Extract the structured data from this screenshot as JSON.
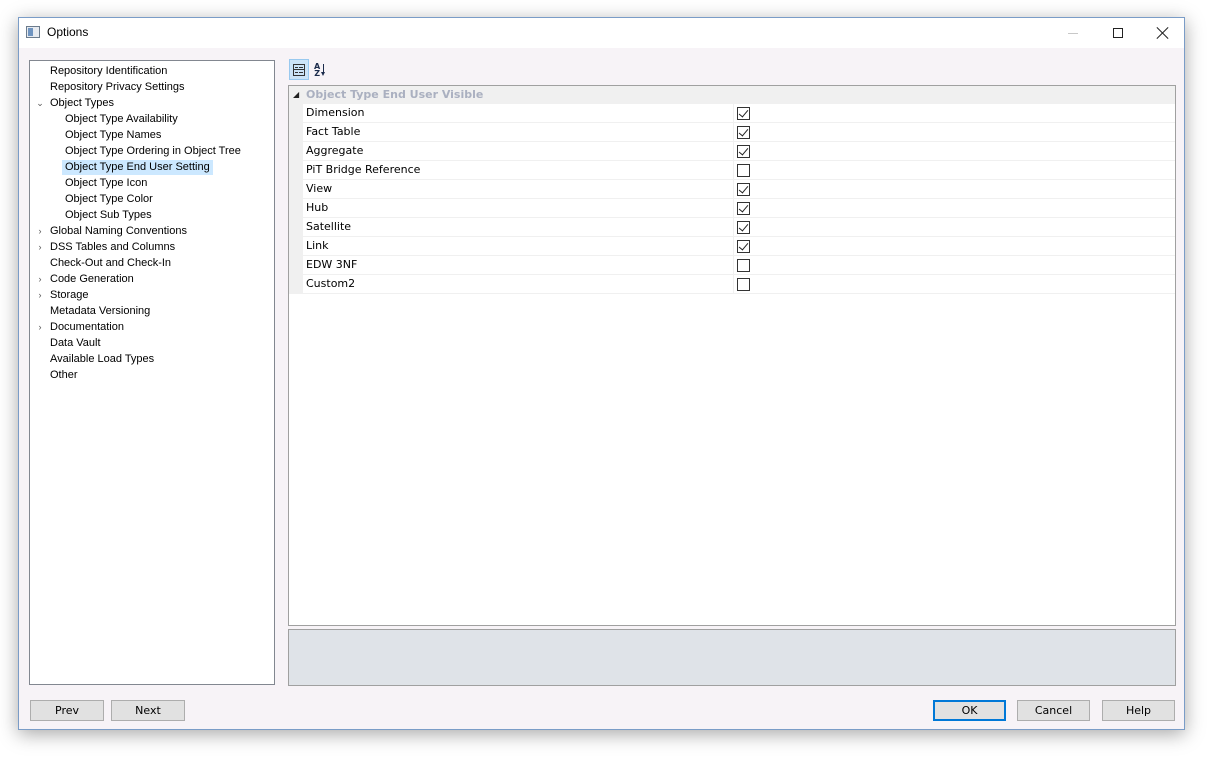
{
  "window": {
    "title": "Options",
    "icon": "options-window-icon",
    "controls": [
      "minimize-icon",
      "maximize-icon",
      "close-icon"
    ]
  },
  "tree": {
    "items": [
      {
        "label": "Repository Identification",
        "level": 0
      },
      {
        "label": "Repository Privacy Settings",
        "level": 0
      },
      {
        "label": "Object Types",
        "level": 0,
        "expanded": true
      },
      {
        "label": "Object Type Availability",
        "level": 1
      },
      {
        "label": "Object Type Names",
        "level": 1
      },
      {
        "label": "Object Type Ordering in Object Tree",
        "level": 1
      },
      {
        "label": "Object Type End User Setting",
        "level": 1,
        "selected": true
      },
      {
        "label": "Object Type Icon",
        "level": 1
      },
      {
        "label": "Object Type Color",
        "level": 1
      },
      {
        "label": "Object Sub Types",
        "level": 1
      },
      {
        "label": "Global Naming Conventions",
        "level": 0,
        "collapsed": true
      },
      {
        "label": "DSS Tables and Columns",
        "level": 0,
        "collapsed": true
      },
      {
        "label": "Check-Out and Check-In",
        "level": 0
      },
      {
        "label": "Code Generation",
        "level": 0,
        "collapsed": true
      },
      {
        "label": "Storage",
        "level": 0,
        "collapsed": true
      },
      {
        "label": "Metadata Versioning",
        "level": 0
      },
      {
        "label": "Documentation",
        "level": 0,
        "collapsed": true
      },
      {
        "label": "Data Vault",
        "level": 0
      },
      {
        "label": "Available Load Types",
        "level": 0
      },
      {
        "label": "Other",
        "level": 0
      }
    ]
  },
  "toolbar": {
    "categorized_icon": "categorized-view-icon",
    "alphabetical_icon": "sort-alphabetical-icon",
    "alphabetical_glyph": "A\nZ"
  },
  "grid": {
    "category": "Object Type End User Visible",
    "properties": [
      {
        "name": "Dimension",
        "checked": true
      },
      {
        "name": "Fact Table",
        "checked": true
      },
      {
        "name": "Aggregate",
        "checked": true
      },
      {
        "name": "PiT Bridge Reference",
        "checked": false
      },
      {
        "name": "View",
        "checked": true
      },
      {
        "name": "Hub",
        "checked": true
      },
      {
        "name": "Satellite",
        "checked": true
      },
      {
        "name": "Link",
        "checked": true
      },
      {
        "name": "EDW 3NF",
        "checked": false
      },
      {
        "name": "Custom2",
        "checked": false
      }
    ]
  },
  "buttons": {
    "prev": "Prev",
    "next": "Next",
    "ok": "OK",
    "cancel": "Cancel",
    "help": "Help"
  }
}
